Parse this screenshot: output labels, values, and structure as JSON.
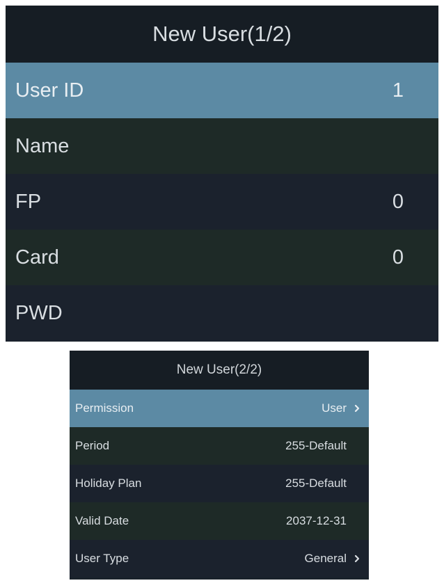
{
  "screen1": {
    "title": "New User(1/2)",
    "rows": [
      {
        "label": "User ID",
        "value": "1"
      },
      {
        "label": "Name",
        "value": ""
      },
      {
        "label": "FP",
        "value": "0"
      },
      {
        "label": "Card",
        "value": "0"
      },
      {
        "label": "PWD",
        "value": ""
      }
    ]
  },
  "screen2": {
    "title": "New User(2/2)",
    "rows": [
      {
        "label": "Permission",
        "value": "User",
        "icon": "chevron-right-icon"
      },
      {
        "label": "Period",
        "value": "255-Default"
      },
      {
        "label": "Holiday Plan",
        "value": "255-Default"
      },
      {
        "label": "Valid Date",
        "value": "2037-12-31"
      },
      {
        "label": "User Type",
        "value": "General",
        "icon": "chevron-right-icon"
      }
    ]
  },
  "colors": {
    "selected_row": "#5c8aa4",
    "panel_bg": "#1a222b",
    "alt_row_a": "#1e2a27",
    "alt_row_b": "#1b222d",
    "text": "#d9dee2"
  }
}
